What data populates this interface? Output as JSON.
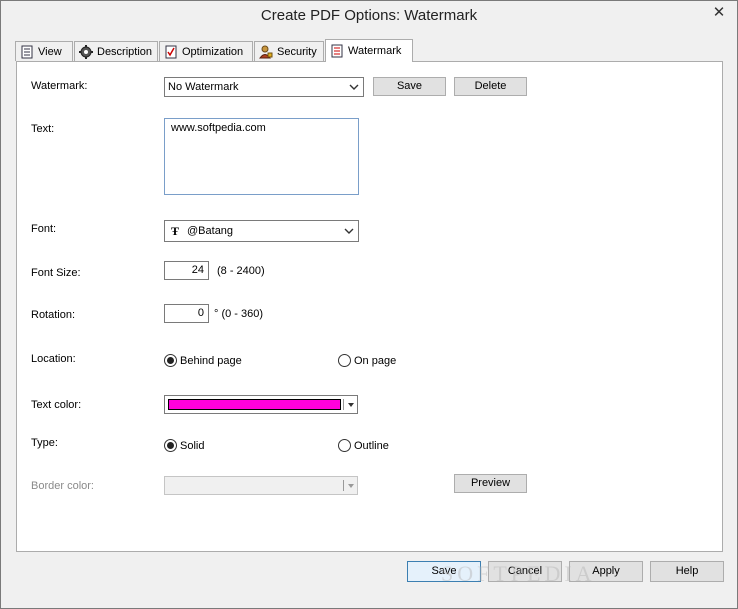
{
  "window": {
    "title": "Create PDF Options: Watermark"
  },
  "tabs": [
    {
      "label": "View",
      "icon": "document-icon"
    },
    {
      "label": "Description",
      "icon": "gear-icon"
    },
    {
      "label": "Optimization",
      "icon": "checklist-icon"
    },
    {
      "label": "Security",
      "icon": "user-lock-icon"
    },
    {
      "label": "Watermark",
      "icon": "watermark-doc-icon"
    }
  ],
  "form": {
    "watermark_label": "Watermark:",
    "watermark_value": "No Watermark",
    "save_label": "Save",
    "delete_label": "Delete",
    "text_label": "Text:",
    "text_value": "www.softpedia.com",
    "font_label": "Font:",
    "font_value": "@Batang",
    "font_size_label": "Font Size:",
    "font_size_value": "24",
    "font_size_range": "(8  -  2400)",
    "rotation_label": "Rotation:",
    "rotation_value": "0",
    "rotation_range": "° (0  -  360)",
    "location_label": "Location:",
    "location_behind": "Behind page",
    "location_on": "On page",
    "text_color_label": "Text color:",
    "text_color": "#ff00dd",
    "type_label": "Type:",
    "type_solid": "Solid",
    "type_outline": "Outline",
    "border_color_label": "Border color:",
    "preview_label": "Preview"
  },
  "footer": {
    "save": "Save",
    "cancel": "Cancel",
    "apply": "Apply",
    "help": "Help"
  },
  "overlay": {
    "text": "SOFTPEDIA"
  }
}
